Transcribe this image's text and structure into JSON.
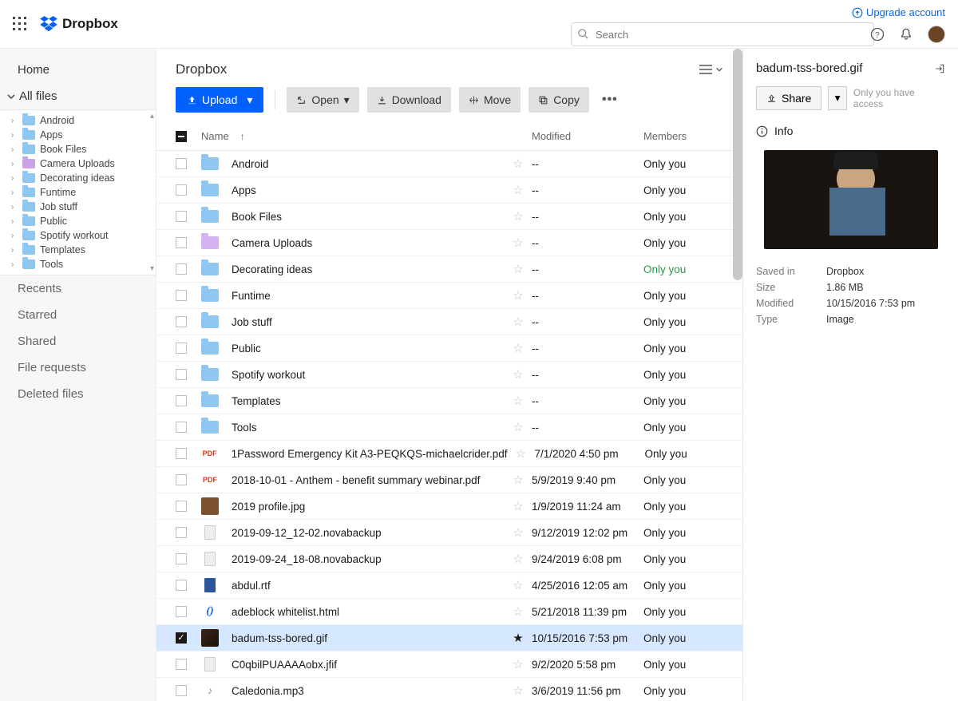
{
  "header": {
    "brand": "Dropbox",
    "upgrade_label": "Upgrade account",
    "search_placeholder": "Search"
  },
  "sidebar": {
    "home_label": "Home",
    "all_files_label": "All files",
    "folders": [
      {
        "label": "Android",
        "variant": "blue"
      },
      {
        "label": "Apps",
        "variant": "blue"
      },
      {
        "label": "Book Files",
        "variant": "blue"
      },
      {
        "label": "Camera Uploads",
        "variant": "purple"
      },
      {
        "label": "Decorating ideas",
        "variant": "blue"
      },
      {
        "label": "Funtime",
        "variant": "blue"
      },
      {
        "label": "Job stuff",
        "variant": "blue"
      },
      {
        "label": "Public",
        "variant": "blue"
      },
      {
        "label": "Spotify workout",
        "variant": "blue"
      },
      {
        "label": "Templates",
        "variant": "blue"
      },
      {
        "label": "Tools",
        "variant": "blue"
      }
    ],
    "recents_label": "Recents",
    "starred_label": "Starred",
    "shared_label": "Shared",
    "file_requests_label": "File requests",
    "deleted_label": "Deleted files"
  },
  "breadcrumb": "Dropbox",
  "toolbar": {
    "upload_label": "Upload",
    "open_label": "Open",
    "download_label": "Download",
    "move_label": "Move",
    "copy_label": "Copy"
  },
  "columns": {
    "name": "Name",
    "modified": "Modified",
    "members": "Members"
  },
  "rows": [
    {
      "type": "folder",
      "name": "Android",
      "modified": "--",
      "members": "Only you"
    },
    {
      "type": "folder",
      "name": "Apps",
      "modified": "--",
      "members": "Only you"
    },
    {
      "type": "folder",
      "name": "Book Files",
      "modified": "--",
      "members": "Only you"
    },
    {
      "type": "folder",
      "variant": "purple",
      "name": "Camera Uploads",
      "modified": "--",
      "members": "Only you"
    },
    {
      "type": "folder",
      "name": "Decorating ideas",
      "modified": "--",
      "members": "Only you",
      "members_green": true
    },
    {
      "type": "folder",
      "name": "Funtime",
      "modified": "--",
      "members": "Only you"
    },
    {
      "type": "folder",
      "name": "Job stuff",
      "modified": "--",
      "members": "Only you"
    },
    {
      "type": "folder",
      "name": "Public",
      "modified": "--",
      "members": "Only you"
    },
    {
      "type": "folder",
      "name": "Spotify workout",
      "modified": "--",
      "members": "Only you"
    },
    {
      "type": "folder",
      "name": "Templates",
      "modified": "--",
      "members": "Only you"
    },
    {
      "type": "folder",
      "name": "Tools",
      "modified": "--",
      "members": "Only you"
    },
    {
      "type": "pdf",
      "name": "1Password Emergency Kit A3-PEQKQS-michaelcrider.pdf",
      "modified": "7/1/2020 4:50 pm",
      "members": "Only you"
    },
    {
      "type": "pdf",
      "name": "2018-10-01 - Anthem - benefit summary webinar.pdf",
      "modified": "5/9/2019 9:40 pm",
      "members": "Only you"
    },
    {
      "type": "image",
      "name": "2019 profile.jpg",
      "modified": "1/9/2019 11:24 am",
      "members": "Only you"
    },
    {
      "type": "generic",
      "name": "2019-09-12_12-02.novabackup",
      "modified": "9/12/2019 12:02 pm",
      "members": "Only you"
    },
    {
      "type": "generic",
      "name": "2019-09-24_18-08.novabackup",
      "modified": "9/24/2019 6:08 pm",
      "members": "Only you"
    },
    {
      "type": "doc",
      "name": "abdul.rtf",
      "modified": "4/25/2016 12:05 am",
      "members": "Only you"
    },
    {
      "type": "html",
      "name": "adeblock whitelist.html",
      "modified": "5/21/2018 11:39 pm",
      "members": "Only you"
    },
    {
      "type": "gif",
      "name": "badum-tss-bored.gif",
      "modified": "10/15/2016 7:53 pm",
      "members": "Only you",
      "selected": true,
      "starred": true
    },
    {
      "type": "generic",
      "name": "C0qbilPUAAAAobx.jfif",
      "modified": "9/2/2020 5:58 pm",
      "members": "Only you"
    },
    {
      "type": "audio",
      "name": "Caledonia.mp3",
      "modified": "3/6/2019 11:56 pm",
      "members": "Only you"
    }
  ],
  "details": {
    "title": "badum-tss-bored.gif",
    "share_label": "Share",
    "access_note": "Only you have access",
    "info_label": "Info",
    "meta": {
      "saved_in_label": "Saved in",
      "saved_in_value": "Dropbox",
      "size_label": "Size",
      "size_value": "1.86 MB",
      "modified_label": "Modified",
      "modified_value": "10/15/2016 7:53 pm",
      "type_label": "Type",
      "type_value": "Image"
    }
  }
}
